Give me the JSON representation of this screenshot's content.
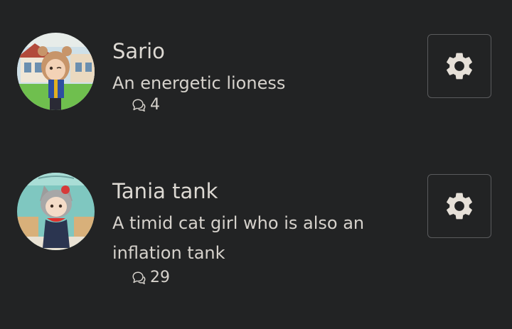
{
  "characters": [
    {
      "name": "Sario",
      "description": "An energetic lioness",
      "chat_count": "4"
    },
    {
      "name": "Tania tank",
      "description": "A timid cat girl who is also an inflation tank",
      "chat_count": "29"
    }
  ],
  "icons": {
    "chat": "chat-bubble-icon",
    "settings": "gear-icon"
  },
  "colors": {
    "background": "#222324",
    "text": "#ddd9d3",
    "button_border": "#5a5b5d",
    "icon": "#e6e0d8"
  }
}
